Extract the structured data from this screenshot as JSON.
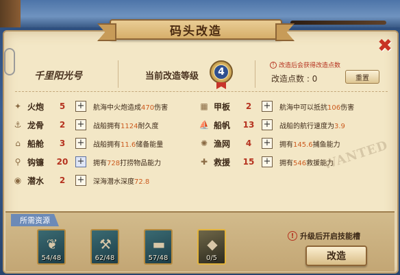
{
  "window": {
    "title": "码头改造",
    "close_glyph": "✖"
  },
  "header": {
    "ship_name": "千里阳光号",
    "level_label": "当前改造等级",
    "level_value": "4",
    "notice": "改造后会获得改造点数",
    "points_label": "改造点数 : 0",
    "reset_label": "重置"
  },
  "stats_left": [
    {
      "icon": "cannon-icon",
      "glyph": "✦",
      "name": "火炮",
      "value": "5",
      "desc_pre": "航海中火炮造成",
      "desc_num": "470",
      "desc_post": "伤害",
      "active": false
    },
    {
      "icon": "keel-icon",
      "glyph": "⚓",
      "name": "龙骨",
      "value": "2",
      "desc_pre": "战船拥有",
      "desc_num": "1124",
      "desc_post": "耐久度",
      "active": false
    },
    {
      "icon": "cabin-icon",
      "glyph": "⌂",
      "name": "船舱",
      "value": "3",
      "desc_pre": "战船拥有",
      "desc_num": "11.6",
      "desc_post": "储备能量",
      "active": false
    },
    {
      "icon": "hook-icon",
      "glyph": "⚲",
      "name": "钩镰",
      "value": "20",
      "desc_pre": "拥有",
      "desc_num": "728",
      "desc_post": "打捞物品能力",
      "active": true
    },
    {
      "icon": "diving-icon",
      "glyph": "◉",
      "name": "潜水",
      "value": "2",
      "desc_pre": "深海潜水深度",
      "desc_num": "72.8",
      "desc_post": "",
      "active": false
    }
  ],
  "stats_right": [
    {
      "icon": "deck-icon",
      "glyph": "▦",
      "name": "甲板",
      "value": "2",
      "desc_pre": "航海中可以抵抗",
      "desc_num": "106",
      "desc_post": "伤害",
      "active": false
    },
    {
      "icon": "sail-icon",
      "glyph": "⛵",
      "name": "船帆",
      "value": "13",
      "desc_pre": "战船的航行速度为",
      "desc_num": "3.9",
      "desc_post": "",
      "active": false
    },
    {
      "icon": "net-icon",
      "glyph": "✺",
      "name": "渔网",
      "value": "4",
      "desc_pre": "拥有",
      "desc_num": "145.6",
      "desc_post": "捕鱼能力",
      "active": false
    },
    {
      "icon": "rescue-icon",
      "glyph": "✚",
      "name": "救援",
      "value": "15",
      "desc_pre": "拥有",
      "desc_num": "546",
      "desc_post": "救援能力",
      "active": false
    }
  ],
  "watermark": "WANTED",
  "resources": {
    "title": "所需资源",
    "items": [
      {
        "icon": "branch-icon",
        "glyph": "❦",
        "count": "54/48",
        "gold": false
      },
      {
        "icon": "nails-icon",
        "glyph": "⚒",
        "count": "62/48",
        "gold": false
      },
      {
        "icon": "log-icon",
        "glyph": "▬",
        "count": "57/48",
        "gold": false
      },
      {
        "icon": "silver-ore-icon",
        "glyph": "◆",
        "count": "0/5",
        "gold": true
      }
    ],
    "unlock_note": "升级后开启技能槽",
    "upgrade_label": "改造"
  }
}
